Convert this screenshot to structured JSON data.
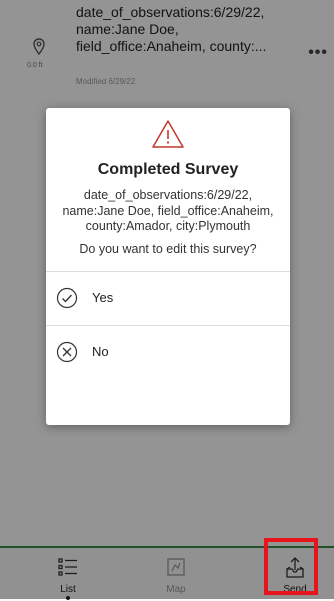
{
  "list_item": {
    "lines": [
      "date_of_observations:6/29/22,",
      "name:Jane Doe,",
      "field_office:Anaheim, county:..."
    ],
    "distance": "0.0 ft",
    "modified": "Modified 6/29/22",
    "more_icon": "more-horizontal-icon"
  },
  "dialog": {
    "icon": "warning-icon",
    "title": "Completed Survey",
    "message": "date_of_observations:6/29/22, name:Jane Doe, field_office:Anaheim, county:Amador, city:Plymouth",
    "question": "Do you want to edit this survey?",
    "options": [
      {
        "label": "Yes",
        "icon": "check-circle-icon"
      },
      {
        "label": "No",
        "icon": "x-circle-icon"
      }
    ]
  },
  "tabbar": {
    "tabs": [
      {
        "label": "List",
        "icon": "list-icon",
        "active": true
      },
      {
        "label": "Map",
        "icon": "map-icon",
        "active": false
      },
      {
        "label": "Send",
        "icon": "send-icon",
        "active": false
      }
    ],
    "accent_color": "#3a8a52",
    "highlight_color": "#e8141b"
  }
}
